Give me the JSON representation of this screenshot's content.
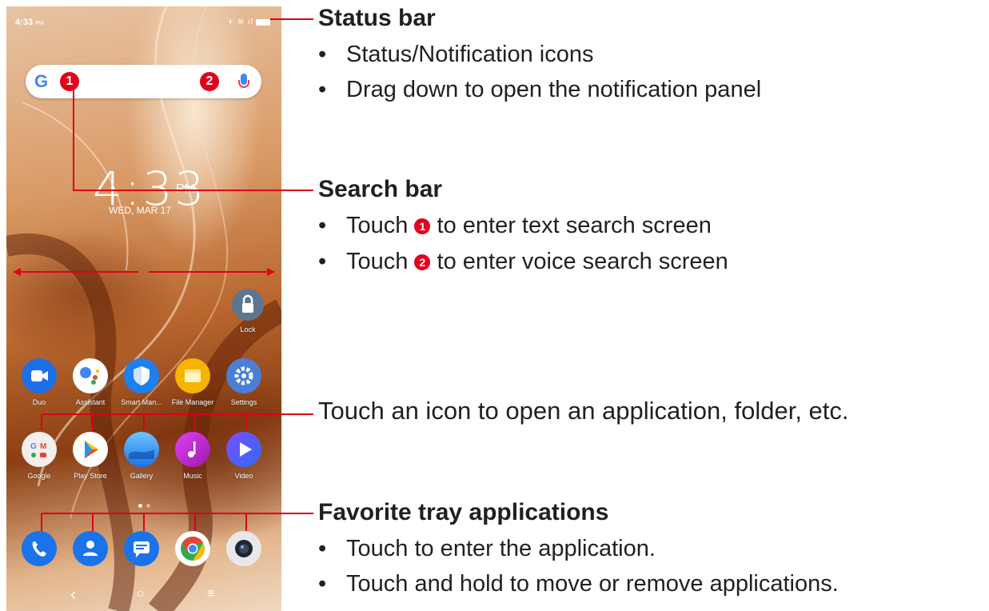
{
  "status_bar": {
    "time": "4:33",
    "ampm": "PM",
    "icons": " ◉ ≈ ᴿLTE .∥"
  },
  "search": {
    "g_logo": "G",
    "badge1": "1",
    "badge2": "2"
  },
  "clock": {
    "time": "4:33",
    "ampm": "PM",
    "date": "WED, MAR 17"
  },
  "lock_app": {
    "label": "Lock"
  },
  "apps_row1": [
    {
      "label": "Duo",
      "icon": "duo-icon",
      "color": "#1e6fe6"
    },
    {
      "label": "Assistant",
      "icon": "assistant-icon",
      "color": "#ffffff"
    },
    {
      "label": "Smart Man...",
      "icon": "shield-icon",
      "color": "#1e7ff0"
    },
    {
      "label": "File Manager",
      "icon": "folder-icon",
      "color": "#f6b400"
    },
    {
      "label": "Settings",
      "icon": "gear-icon",
      "color": "#4a7fd6"
    }
  ],
  "apps_row2": [
    {
      "label": "Google",
      "icon": "google-folder-icon",
      "color": "#f2efec"
    },
    {
      "label": "Play Store",
      "icon": "play-store-icon",
      "color": "#ffffff"
    },
    {
      "label": "Gallery",
      "icon": "gallery-icon",
      "color": "#2a9ee6"
    },
    {
      "label": "Music",
      "icon": "music-icon",
      "color": "#c01ab8"
    },
    {
      "label": "Video",
      "icon": "video-icon",
      "color": "#4a66f0"
    }
  ],
  "tray": [
    {
      "icon": "phone-icon",
      "color": "#1a73e8"
    },
    {
      "icon": "contacts-icon",
      "color": "#1a73e8"
    },
    {
      "icon": "messages-icon",
      "color": "#1a73e8"
    },
    {
      "icon": "chrome-icon",
      "color": "#ffffff"
    },
    {
      "icon": "camera-icon",
      "color": "#e8e8ea"
    }
  ],
  "navbar": {
    "back": "‹",
    "home": "○",
    "menu": "≡"
  },
  "callouts": {
    "status_bar": {
      "title": "Status bar",
      "bullets": [
        "Status/Notification icons",
        "Drag down to open the notification panel"
      ]
    },
    "search_bar": {
      "title": "Search bar",
      "bullet1_pre": "Touch ",
      "bullet1_num": "1",
      "bullet1_post": " to enter text search screen",
      "bullet2_pre": "Touch ",
      "bullet2_num": "2",
      "bullet2_post": " to enter voice search screen"
    },
    "icon_note": "Touch an icon to open an application, folder, etc.",
    "favorites": {
      "title": "Favorite tray applications",
      "bullets": [
        "Touch to enter the application.",
        "Touch and hold to move or remove applications."
      ]
    }
  },
  "colors": {
    "accent_red": "#e2001a",
    "callout_line": "#d9001b"
  }
}
